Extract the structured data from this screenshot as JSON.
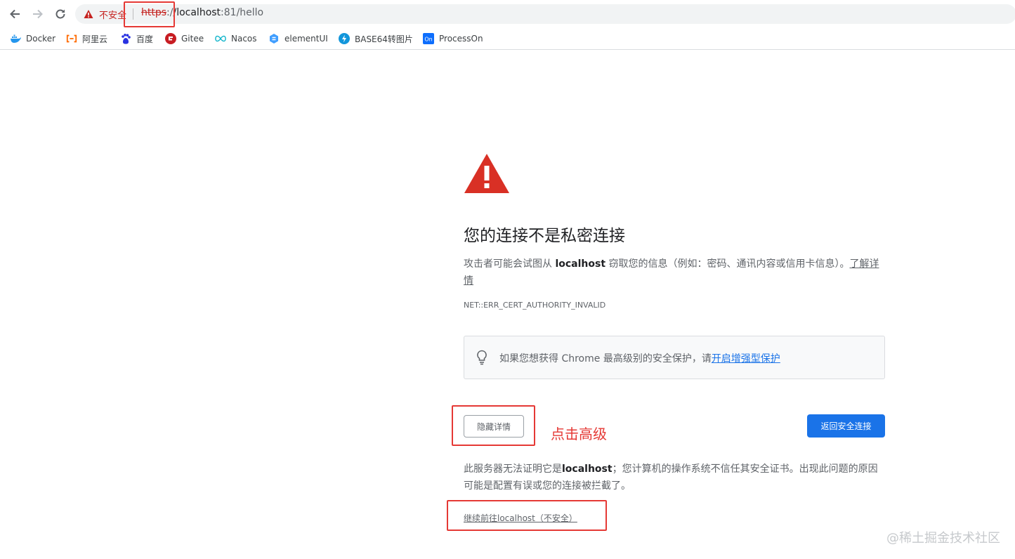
{
  "browser": {
    "omnibox": {
      "security_label": "不安全",
      "url_scheme": "https",
      "url_scheme_sep": ":/",
      "url_host": "/localhost",
      "url_rest": ":81/hello"
    },
    "bookmarks": [
      {
        "label": "Docker",
        "icon": "docker-icon"
      },
      {
        "label": "阿里云",
        "icon": "aliyun-icon"
      },
      {
        "label": "百度",
        "icon": "baidu-icon"
      },
      {
        "label": "Gitee",
        "icon": "gitee-icon"
      },
      {
        "label": "Nacos",
        "icon": "nacos-icon"
      },
      {
        "label": "elementUI",
        "icon": "elementui-icon"
      },
      {
        "label": "BASE64转图片",
        "icon": "base64-icon"
      },
      {
        "label": "ProcessOn",
        "icon": "processon-icon"
      }
    ]
  },
  "interstitial": {
    "heading": "您的连接不是私密连接",
    "explain_prefix": "攻击者可能会试图从 ",
    "explain_host": "localhost",
    "explain_suffix": " 窃取您的信息（例如：密码、通讯内容或信用卡信息）。",
    "learn_more": "了解详情",
    "error_code": "NET::ERR_CERT_AUTHORITY_INVALID",
    "tip_text": "如果您想获得 Chrome 最高级别的安全保护，请",
    "tip_link": "开启增强型保护",
    "details_button": "隐藏详情",
    "back_button": "返回安全连接",
    "detail_prefix": "此服务器无法证明它是",
    "detail_host": "localhost",
    "detail_suffix": "；您计算机的操作系统不信任其安全证书。出现此问题的原因可能是配置有误或您的连接被拦截了。",
    "proceed_link": "继续前往localhost（不安全）"
  },
  "annotation": {
    "click_hint": "点击高级"
  },
  "watermark": "@稀土掘金技术社区",
  "colors": {
    "warning_red": "#d93025",
    "primary_blue": "#1a73e8",
    "annotation_red": "#e53935"
  }
}
